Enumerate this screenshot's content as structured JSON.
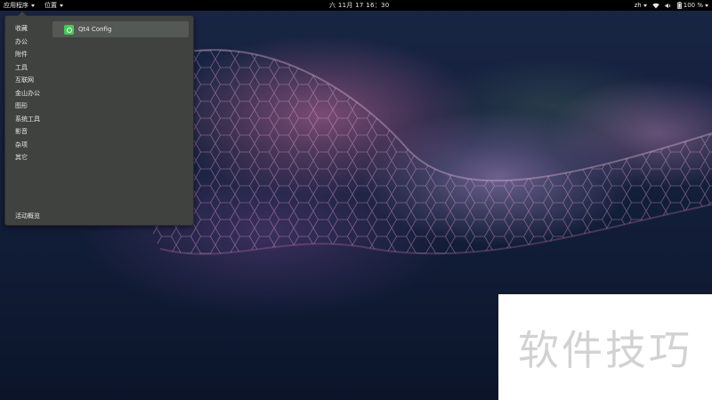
{
  "topbar": {
    "applications_label": "应用程序",
    "places_label": "位置",
    "clock": "六 11月 17  16：30",
    "language": "zh",
    "battery_percent": "100 %",
    "icons": [
      "dropdown-arrow-icon",
      "wifi-icon",
      "volume-icon",
      "battery-icon",
      "chevron-down-icon"
    ]
  },
  "app_menu": {
    "categories": [
      {
        "label": "收藏"
      },
      {
        "label": "办公"
      },
      {
        "label": "附件"
      },
      {
        "label": "工具"
      },
      {
        "label": "互联网"
      },
      {
        "label": "金山办公"
      },
      {
        "label": "图形"
      },
      {
        "label": "系统工具"
      },
      {
        "label": "影音"
      },
      {
        "label": "杂项"
      },
      {
        "label": "其它"
      }
    ],
    "activities_label": "活动概览",
    "apps": [
      {
        "label": "Qt4 Config",
        "icon": "qt-icon"
      }
    ],
    "colors": {
      "panel_bg": "#3f423f",
      "selected_bg": "#555955"
    }
  },
  "watermark": {
    "text": "软件技巧"
  }
}
